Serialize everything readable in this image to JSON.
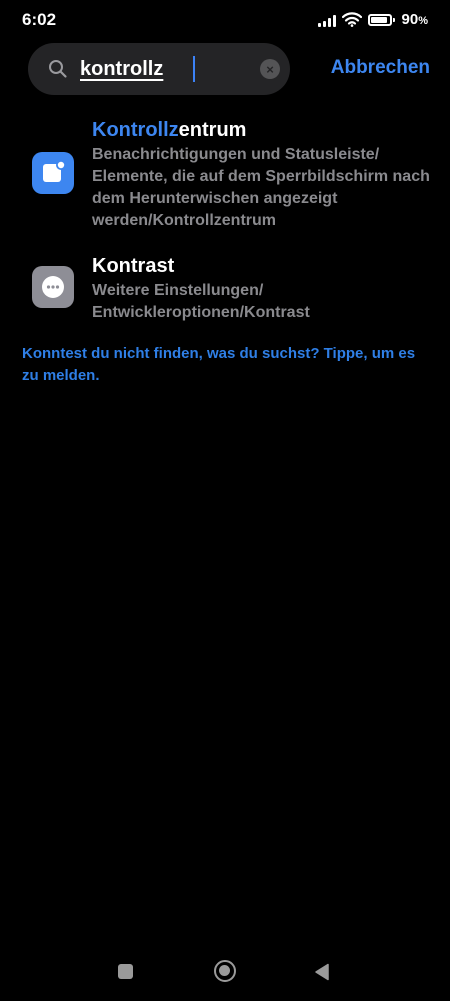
{
  "status_bar": {
    "time": "6:02",
    "battery_percent": "90",
    "battery_symbol": "%",
    "battery_level": 0.9,
    "icons": [
      "signal-icon",
      "wifi-icon",
      "battery-icon"
    ]
  },
  "search": {
    "value": "kontrollz",
    "clear_icon": "×",
    "cancel_label": "Abbrechen",
    "accent_color": "#3d86f0"
  },
  "results": [
    {
      "title_highlight": "Kontrollz",
      "title_rest": "entrum",
      "description": "Benachrichtigungen und Statusleiste/ Elemente, die auf dem Sperrbildschirm nach dem Herunterwischen angezeigt werden/Kontrollzentrum",
      "icon": "control-center-icon",
      "icon_color": "#3d86f0"
    },
    {
      "title_highlight": "",
      "title_rest": "Kontrast",
      "description": "Weitere Einstellungen/ Entwickleroptionen/Kontrast",
      "icon": "more-dots-icon",
      "icon_color": "#8e8e96"
    }
  ],
  "not_found_text": "Konntest du nicht finden, was du suchst? Tippe, um es zu melden.",
  "nav_bar": {
    "icons": [
      "recents-icon",
      "home-icon",
      "back-icon"
    ]
  }
}
